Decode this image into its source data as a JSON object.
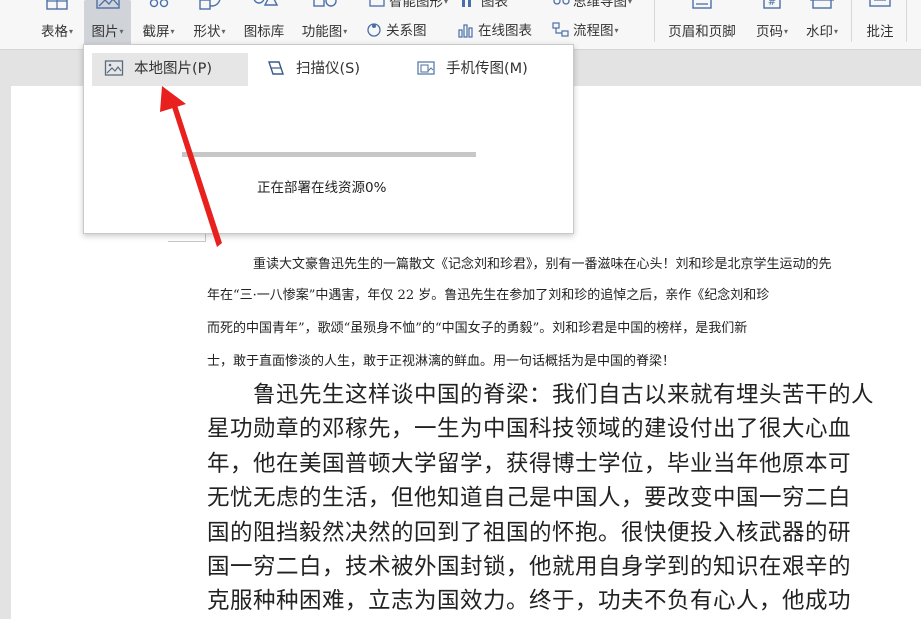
{
  "ribbon": {
    "buttons": [
      {
        "label": "表格",
        "has_menu": true
      },
      {
        "label": "图片",
        "has_menu": true,
        "active": true
      },
      {
        "label": "截屏",
        "has_menu": true
      },
      {
        "label": "形状",
        "has_menu": true
      },
      {
        "label": "图标库",
        "has_menu": false
      },
      {
        "label": "功能图",
        "has_menu": true
      },
      {
        "label": "页眉和页脚",
        "has_menu": false
      },
      {
        "label": "页码",
        "has_menu": true
      },
      {
        "label": "水印",
        "has_menu": true
      },
      {
        "label": "批注",
        "has_menu": false
      }
    ],
    "small_buttons": {
      "smartart": "智能图形",
      "chart": "图表",
      "mindmap": "思维导图",
      "relation": "关系图",
      "online_chart": "在线图表",
      "flowchart": "流程图"
    },
    "caret": "▾"
  },
  "picture_menu": {
    "items": [
      {
        "label": "本地图片(P)",
        "icon": "image-icon",
        "selected": true
      },
      {
        "label": "扫描仪(S)",
        "icon": "scanner-icon",
        "selected": false
      },
      {
        "label": "手机传图(M)",
        "icon": "phone-image-icon",
        "selected": false
      }
    ],
    "progress_text": "正在部署在线资源0%",
    "progress_value": 0
  },
  "document": {
    "small_lines": [
      "重读大文豪鲁迅先生的一篇散文《记念刘和珍君》，别有一番滋味在心头！刘和珍是北京学生运动的先",
      "年在“三·一八惨案”中遇害，年仅 22 岁。鲁迅先生在参加了刘和珍的追悼之后，亲作《纪念刘和珍",
      "而死的中国青年”，歌颂“虽殒身不恤”的“中国女子的勇毅”。刘和珍君是中国的榜样，是我们新",
      "士，敢于直面惨淡的人生，敢于正视淋漓的鲜血。用一句话概括为是中国的脊梁！"
    ],
    "big_lines": [
      "鲁迅先生这样谈中国的脊梁：我们自古以来就有埋头苦干的人",
      "星功勋章的邓稼先，一生为中国科技领域的建设付出了很大心血",
      "年，他在美国普顿大学留学，获得博士学位，毕业当年他原本可",
      "无忧无虑的生活，但他知道自己是中国人，要改变中国一穷二白",
      "国的阻挡毅然决然的回到了祖国的怀抱。很快便投入核武器的研",
      "国一穷二白，技术被外国封锁，他就用自身学到的知识在艰辛的",
      "克服种种困难，立志为国效力。终于，功夫不负有心人，他成功"
    ]
  },
  "colors": {
    "annotation_arrow": "#e8201e",
    "ribbon_bg": "#f7f7f7",
    "selected_item_bg": "#e6e6e6",
    "progress_track": "#c7c7c7"
  }
}
